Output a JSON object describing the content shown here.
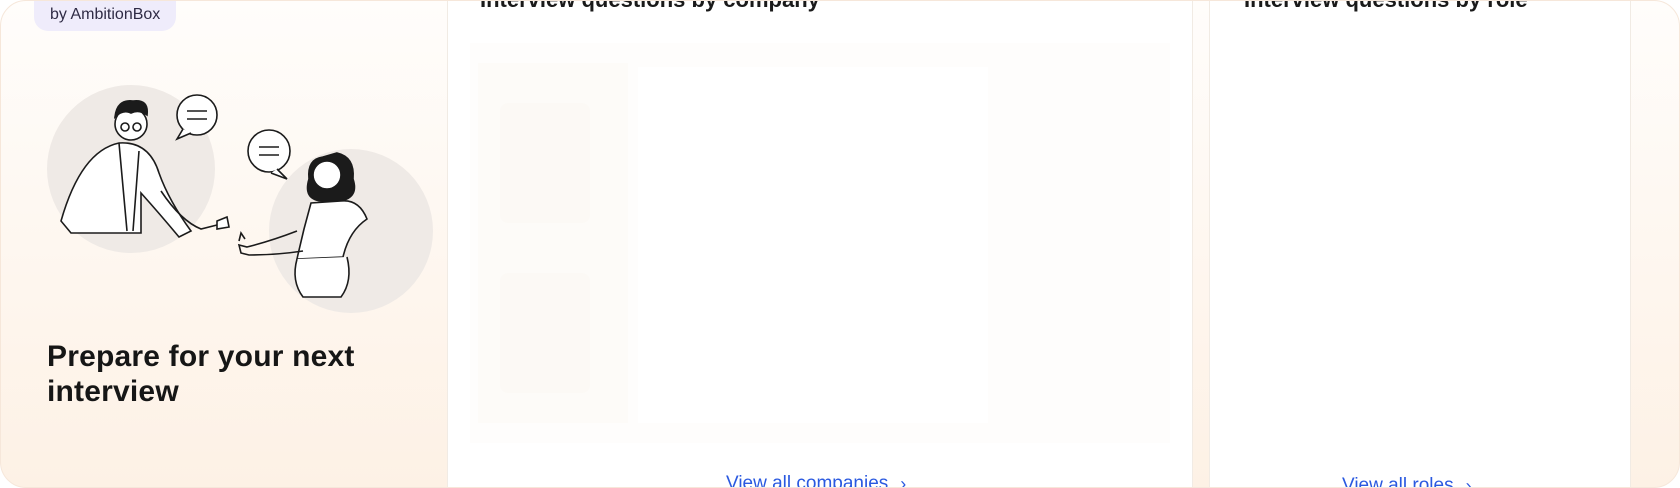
{
  "badge": {
    "label": "by AmbitionBox"
  },
  "hero": {
    "title": "Prepare for your next interview"
  },
  "company_panel": {
    "title": "Interview questions by company",
    "link_label": "View all companies",
    "link_icon": "chevron-right-icon"
  },
  "role_panel": {
    "title": "Interview questions by role",
    "link_label": "View all roles",
    "link_icon": "chevron-right-icon"
  },
  "colors": {
    "accent": "#2a59e0",
    "hero_text": "#161616",
    "badge_bg": "#efecfb"
  }
}
